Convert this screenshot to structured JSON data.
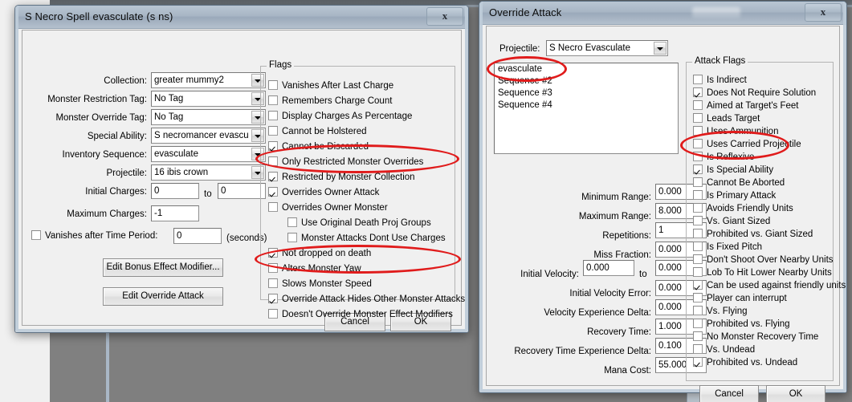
{
  "spell_dialog": {
    "title": "S Necro Spell evasculate (s ns)",
    "close_label": "x",
    "fields": [
      {
        "label": "Collection:",
        "value": "greater mummy2"
      },
      {
        "label": "Monster Restriction Tag:",
        "value": "No Tag"
      },
      {
        "label": "Monster Override Tag:",
        "value": "No Tag"
      },
      {
        "label": "Special Ability:",
        "value": "S necromancer evascula"
      },
      {
        "label": "Inventory Sequence:",
        "value": "evasculate"
      },
      {
        "label": "Projectile:",
        "value": "16 ibis crown"
      }
    ],
    "initial_charges": {
      "label": "Initial Charges:",
      "from": "0",
      "to_label": "to",
      "to": "0"
    },
    "maximum_charges": {
      "label": "Maximum Charges:",
      "value": "-1"
    },
    "vanishes_after_time": {
      "label": "Vanishes after Time Period:",
      "checked": false,
      "value": "0",
      "unit": "(seconds)"
    },
    "buttons": {
      "edit_bonus_effect": "Edit Bonus Effect Modifier...",
      "edit_override_attack": "Edit Override Attack",
      "cancel": "Cancel",
      "ok": "OK"
    },
    "flags_group": {
      "title": "Flags",
      "items": [
        {
          "label": "Vanishes After Last Charge",
          "checked": false,
          "indent": 0
        },
        {
          "label": "Remembers Charge Count",
          "checked": false,
          "indent": 0
        },
        {
          "label": "Display Charges As Percentage",
          "checked": false,
          "indent": 0
        },
        {
          "label": "Cannot be Holstered",
          "checked": false,
          "indent": 0
        },
        {
          "label": "Cannot be Discarded",
          "checked": true,
          "indent": 0
        },
        {
          "label": "Only Restricted Monster Overrides",
          "checked": false,
          "indent": 0
        },
        {
          "label": "Restricted by Monster Collection",
          "checked": true,
          "indent": 0
        },
        {
          "label": "Overrides Owner Attack",
          "checked": true,
          "indent": 0
        },
        {
          "label": "Overrides Owner Monster",
          "checked": false,
          "indent": 0
        },
        {
          "label": "Use Original Death Proj Groups",
          "checked": false,
          "indent": 1
        },
        {
          "label": "Monster Attacks Dont Use Charges",
          "checked": false,
          "indent": 1
        },
        {
          "label": "Not dropped on death",
          "checked": true,
          "indent": 0
        },
        {
          "label": "Alters Monster Yaw",
          "checked": false,
          "indent": 0
        },
        {
          "label": "Slows Monster Speed",
          "checked": false,
          "indent": 0
        },
        {
          "label": "Override Attack Hides Other Monster Attacks",
          "checked": true,
          "indent": 0
        },
        {
          "label": "Doesn't Override Monster Effect Modifiers",
          "checked": false,
          "indent": 0
        }
      ]
    }
  },
  "attack_dialog": {
    "title": "Override Attack",
    "close_label": "x",
    "projectile": {
      "label": "Projectile:",
      "value": "S Necro Evasculate"
    },
    "sequence_list": [
      "evasculate",
      "Sequence #2",
      "Sequence #3",
      "Sequence #4"
    ],
    "numeric_fields": [
      {
        "label": "Minimum Range:",
        "value": "0.000"
      },
      {
        "label": "Maximum Range:",
        "value": "8.000"
      },
      {
        "label": "Repetitions:",
        "value": "1"
      },
      {
        "label": "Miss Fraction:",
        "value": "0.000"
      }
    ],
    "initial_velocity": {
      "label": "Initial Velocity:",
      "from": "0.000",
      "to_label": "to",
      "to": "0.000"
    },
    "numeric_fields_2": [
      {
        "label": "Initial Velocity Error:",
        "value": "0.000"
      },
      {
        "label": "Velocity Experience Delta:",
        "value": "0.000"
      },
      {
        "label": "Recovery Time:",
        "value": "1.000"
      },
      {
        "label": "Recovery Time Experience Delta:",
        "value": "0.100"
      },
      {
        "label": "Mana Cost:",
        "value": "55.000"
      }
    ],
    "buttons": {
      "cancel": "Cancel",
      "ok": "OK"
    },
    "attack_flags_group": {
      "title": "Attack Flags",
      "items": [
        {
          "label": "Is Indirect",
          "checked": false
        },
        {
          "label": "Does Not Require Solution",
          "checked": true
        },
        {
          "label": "Aimed at Target's Feet",
          "checked": false
        },
        {
          "label": "Leads Target",
          "checked": false
        },
        {
          "label": "Uses Ammunition",
          "checked": false
        },
        {
          "label": "Uses Carried Projectile",
          "checked": false
        },
        {
          "label": "Is Reflexive",
          "checked": false
        },
        {
          "label": "Is Special Ability",
          "checked": true
        },
        {
          "label": "Cannot Be Aborted",
          "checked": false
        },
        {
          "label": "Is Primary Attack",
          "checked": false
        },
        {
          "label": "Avoids Friendly Units",
          "checked": false
        },
        {
          "label": "Vs. Giant Sized",
          "checked": false
        },
        {
          "label": "Prohibited vs. Giant Sized",
          "checked": false
        },
        {
          "label": "Is Fixed Pitch",
          "checked": false
        },
        {
          "label": "Don't Shoot Over Nearby Units",
          "checked": false
        },
        {
          "label": "Lob To Hit Lower Nearby Units",
          "checked": false
        },
        {
          "label": "Can be used against friendly units",
          "checked": true
        },
        {
          "label": "Player can interrupt",
          "checked": false
        },
        {
          "label": "Vs. Flying",
          "checked": false
        },
        {
          "label": "Prohibited vs. Flying",
          "checked": false
        },
        {
          "label": "No Monster Recovery Time",
          "checked": false
        },
        {
          "label": "Vs. Undead",
          "checked": false
        },
        {
          "label": "Prohibited vs. Undead",
          "checked": true
        }
      ]
    }
  },
  "annotations": {
    "color": "#e01b1b",
    "ellipses": [
      {
        "name": "overrides-owner-attack-highlight"
      },
      {
        "name": "override-attack-hides-highlight"
      },
      {
        "name": "evasculate-sequence-highlight"
      },
      {
        "name": "is-special-ability-highlight"
      }
    ]
  }
}
